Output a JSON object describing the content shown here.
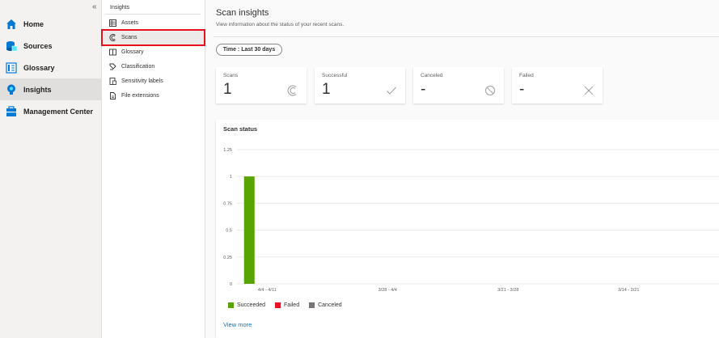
{
  "nav": {
    "collapse_label": "«",
    "items": [
      {
        "label": "Home",
        "icon": "home-icon"
      },
      {
        "label": "Sources",
        "icon": "sources-icon"
      },
      {
        "label": "Glossary",
        "icon": "glossary-icon"
      },
      {
        "label": "Insights",
        "icon": "insights-icon",
        "active": true
      },
      {
        "label": "Management Center",
        "icon": "management-center-icon"
      }
    ]
  },
  "subnav": {
    "header": "Insights",
    "items": [
      {
        "label": "Assets",
        "icon": "assets-icon"
      },
      {
        "label": "Scans",
        "icon": "scans-icon",
        "selected": true
      },
      {
        "label": "Glossary",
        "icon": "glossary-book-icon"
      },
      {
        "label": "Classification",
        "icon": "classification-icon"
      },
      {
        "label": "Sensitivity labels",
        "icon": "sensitivity-labels-icon"
      },
      {
        "label": "File extensions",
        "icon": "file-extensions-icon"
      }
    ]
  },
  "main": {
    "title": "Scan insights",
    "subtitle": "View information about the status of your recent scans.",
    "time_filter": "Time : Last 30 days",
    "cards": [
      {
        "label": "Scans",
        "value": "1",
        "icon": "scan-icon"
      },
      {
        "label": "Successful",
        "value": "1",
        "icon": "checkmark-icon"
      },
      {
        "label": "Canceled",
        "value": "-",
        "icon": "blocked-icon"
      },
      {
        "label": "Failed",
        "value": "-",
        "icon": "close-icon"
      }
    ],
    "view_more": "View more"
  },
  "colors": {
    "succeeded": "#57a300",
    "failed": "#e81123",
    "canceled": "#7a7574",
    "accent": "#0078d4",
    "highlight": "#e8101e"
  },
  "chart_data": {
    "type": "bar",
    "title": "Scan status",
    "categories": [
      "4/4 - 4/11",
      "3/28 - 4/4",
      "3/21 - 3/28",
      "3/14 - 3/21"
    ],
    "series": [
      {
        "name": "Succeeded",
        "values": [
          1,
          0,
          0,
          0
        ],
        "color": "#57a300"
      },
      {
        "name": "Failed",
        "values": [
          0,
          0,
          0,
          0
        ],
        "color": "#e81123"
      },
      {
        "name": "Canceled",
        "values": [
          0,
          0,
          0,
          0
        ],
        "color": "#7a7574"
      }
    ],
    "yticks": [
      "1.25",
      "1",
      "0.75",
      "0.5",
      "0.25",
      "0"
    ],
    "ylim": [
      0,
      1.25
    ],
    "grid": true,
    "legend": "bottom-left"
  }
}
